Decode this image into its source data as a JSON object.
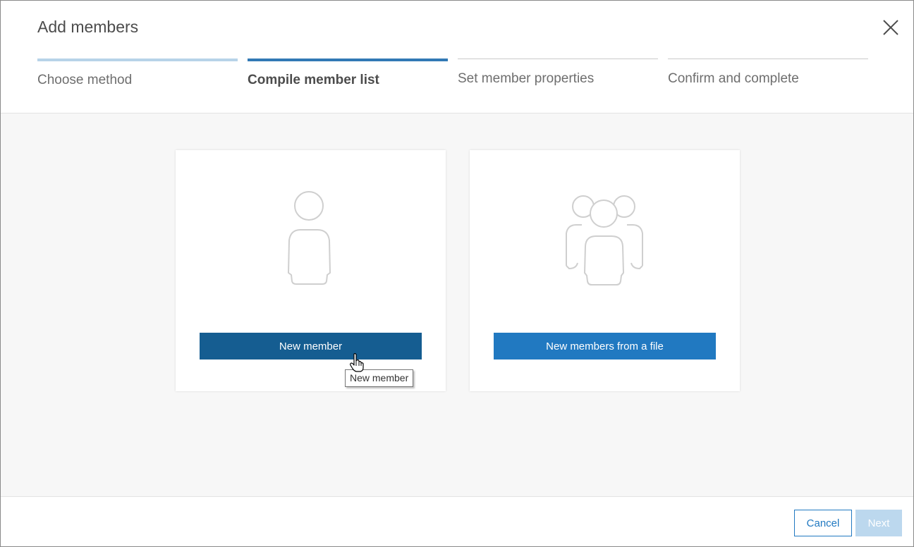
{
  "dialog": {
    "title": "Add members",
    "close_icon": "close-icon"
  },
  "steps": [
    {
      "label": "Choose method",
      "state": "completed"
    },
    {
      "label": "Compile member list",
      "state": "active"
    },
    {
      "label": "Set member properties",
      "state": "upcoming"
    },
    {
      "label": "Confirm and complete",
      "state": "upcoming"
    }
  ],
  "options": [
    {
      "icon": "single-user-icon",
      "button_label": "New member"
    },
    {
      "icon": "user-group-icon",
      "button_label": "New members from a file"
    }
  ],
  "tooltip": {
    "text": "New member"
  },
  "footer": {
    "cancel_label": "Cancel",
    "next_label": "Next"
  },
  "colors": {
    "primary_dark": "#155d91",
    "primary": "#2179c1",
    "step_active": "#3279b5",
    "step_completed": "#b7d3e8",
    "next_disabled": "#bcd8ee"
  }
}
